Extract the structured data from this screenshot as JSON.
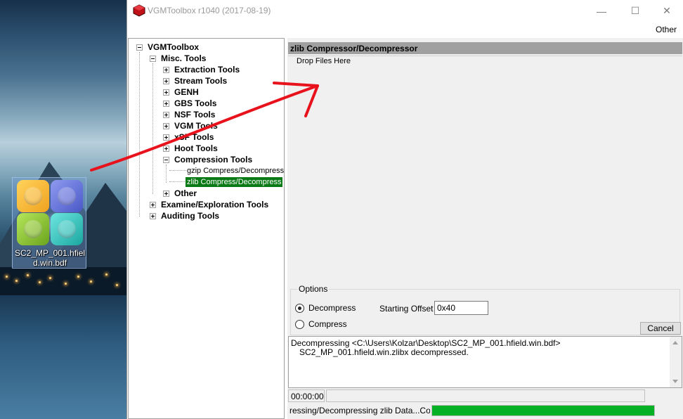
{
  "desktop": {
    "icon_label": "SC2_MP_001.hfield.win.bdf"
  },
  "window": {
    "title": "VGMToolbox r1040 (2017-08-19)",
    "min_glyph": "—",
    "max_glyph": "☐",
    "close_glyph": "✕"
  },
  "menu": {
    "other": "Other"
  },
  "tree": {
    "root": "VGMToolbox",
    "misc": "Misc. Tools",
    "extraction": "Extraction Tools",
    "stream": "Stream Tools",
    "genh": "GENH",
    "gbs": "GBS Tools",
    "nsf": "NSF Tools",
    "vgm": "VGM Tools",
    "xsf": "xSF Tools",
    "hoot": "Hoot Tools",
    "compression": "Compression Tools",
    "gzip": "gzip Compress/Decompress",
    "zlib": "zlib Compress/Decompress",
    "other": "Other",
    "examine": "Examine/Exploration Tools",
    "auditing": "Auditing Tools"
  },
  "panel": {
    "header": "zlib Compressor/Decompressor",
    "drop_label": "Drop Files Here",
    "options_label": "Options",
    "decompress_label": "Decompress",
    "compress_label": "Compress",
    "decompress_selected": true,
    "offset_label": "Starting Offset",
    "offset_value": "0x40",
    "cancel_label": "Cancel"
  },
  "log": {
    "line1": "Decompressing <C:\\Users\\Kolzar\\Desktop\\SC2_MP_001.hfield.win.bdf>",
    "line2": "SC2_MP_001.hfield.win.zlibx decompressed."
  },
  "status": {
    "time": "00:00:00",
    "text": "ressing/Decompressing zlib Data...Cor",
    "progress_percent": 100
  },
  "colors": {
    "selection": "#0a7a16",
    "progress": "#06b025",
    "arrow": "#e8121c"
  }
}
